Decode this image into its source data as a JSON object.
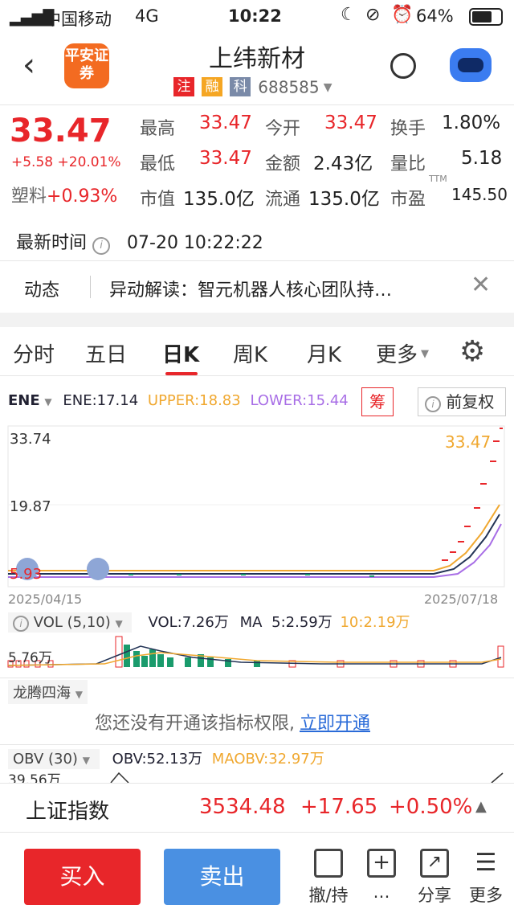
{
  "status_bar": {
    "carrier": "中国移动",
    "network": "4G",
    "time": "10:22",
    "battery": "64%"
  },
  "header": {
    "broker_logo": "平安证券",
    "title": "上纬新材",
    "tags": [
      "注",
      "融",
      "科"
    ],
    "code": "688585"
  },
  "quote": {
    "price": "33.47",
    "change": "+5.58",
    "change_pct": "+20.01%",
    "sector": "塑料",
    "sector_pct": "+0.93%",
    "grid": [
      {
        "label": "最高",
        "value": "33.47",
        "color": "red"
      },
      {
        "label": "今开",
        "value": "33.47",
        "color": "red"
      },
      {
        "label": "换手",
        "value": "1.80%",
        "color": "dark"
      },
      {
        "label": "最低",
        "value": "33.47",
        "color": "red"
      },
      {
        "label": "金额",
        "value": "2.43亿",
        "color": "dark"
      },
      {
        "label": "量比",
        "value": "5.18",
        "color": "dark"
      },
      {
        "label": "市值",
        "value": "135.0亿",
        "color": "dark"
      },
      {
        "label": "流通",
        "value": "135.0亿",
        "color": "dark"
      },
      {
        "label": "市盈",
        "value": "145.50",
        "color": "dark"
      }
    ],
    "pe_sup": "TTM",
    "latest_time_label": "最新时间",
    "latest_time": "07-20 10:22:22"
  },
  "news": {
    "label": "动态",
    "text": "异动解读：智元机器人核心团队持…"
  },
  "chart_tabs": [
    "分时",
    "五日",
    "日K",
    "周K",
    "月K",
    "更多"
  ],
  "active_tab_index": 2,
  "indicator": {
    "name": "ENE",
    "ene": "ENE:17.14",
    "upper": "UPPER:18.83",
    "lower": "LOWER:15.44",
    "chip_btn": "筹",
    "adjust": "前复权"
  },
  "chart_data": {
    "type": "line",
    "y_top_label": "33.74",
    "y_mid_label": "19.87",
    "y_low_label": "5.93",
    "last_price_label": "33.47",
    "x_start": "2025/04/15",
    "x_end": "2025/07/18",
    "ylim": [
      5.93,
      33.74
    ],
    "series": [],
    "x": []
  },
  "volume": {
    "name": "VOL (5,10)",
    "vol": "VOL:7.26万",
    "ma": "MA",
    "ma5": "5:2.59万",
    "ma10": "10:2.19万",
    "max_label": "5.76万"
  },
  "longteng": {
    "name": "龙腾四海",
    "notice": "您还没有开通该指标权限,",
    "link": "立即开通"
  },
  "obv": {
    "name": "OBV (30)",
    "obv": "OBV:52.13万",
    "maobv": "MAOBV:32.97万",
    "max_label": "39.56万"
  },
  "index_bar": {
    "name": "上证指数",
    "value": "3534.48",
    "change": "+17.65",
    "pct": "+0.50%"
  },
  "bottom": {
    "buy": "买入",
    "sell": "卖出",
    "tools": [
      "撤/持",
      "…",
      "分享",
      "更多"
    ]
  }
}
